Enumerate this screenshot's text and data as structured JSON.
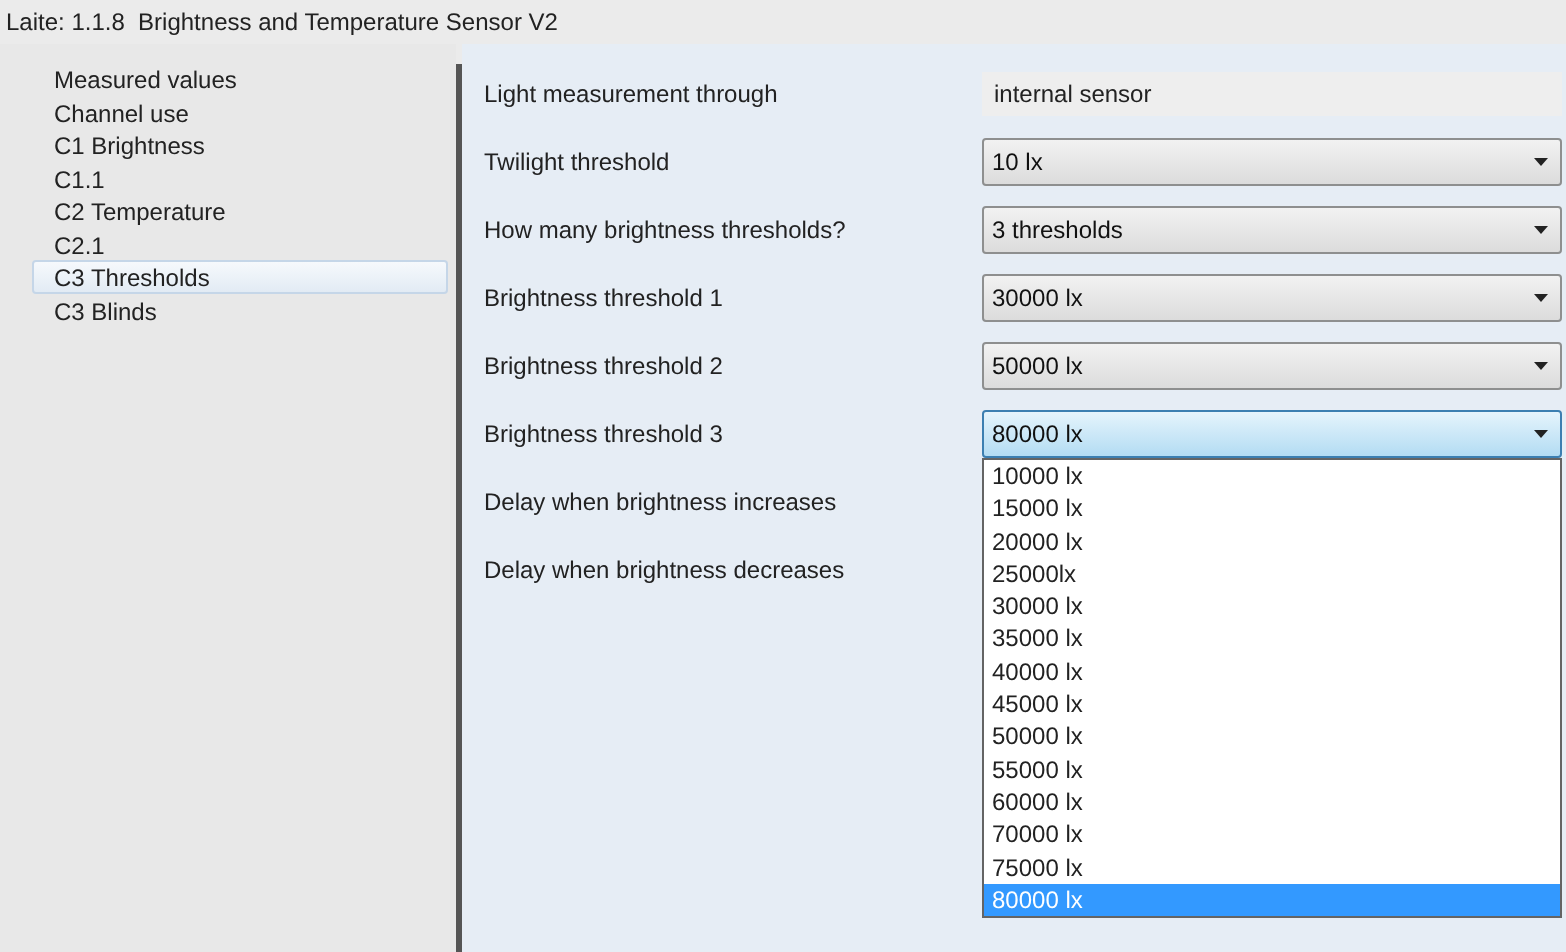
{
  "window": {
    "title": "Laite: 1.1.8  Brightness and Temperature Sensor V2"
  },
  "sidebar": {
    "items": [
      {
        "label": "Measured values",
        "selected": false
      },
      {
        "label": "Channel use",
        "selected": false
      },
      {
        "label": "C1 Brightness",
        "selected": false
      },
      {
        "label": "C1.1",
        "selected": false
      },
      {
        "label": "C2 Temperature",
        "selected": false
      },
      {
        "label": "C2.1",
        "selected": false
      },
      {
        "label": "C3 Thresholds",
        "selected": true
      },
      {
        "label": "C3 Blinds",
        "selected": false
      }
    ]
  },
  "parameters": [
    {
      "label": "Light measurement through",
      "kind": "text",
      "value": "internal sensor"
    },
    {
      "label": "Twilight threshold",
      "kind": "select",
      "value": "10 lx",
      "expanded": false
    },
    {
      "label": "How many brightness thresholds?",
      "kind": "select",
      "value": "3 thresholds",
      "expanded": false
    },
    {
      "label": "Brightness threshold 1",
      "kind": "select",
      "value": "30000 lx",
      "expanded": false
    },
    {
      "label": "Brightness threshold 2",
      "kind": "select",
      "value": "50000 lx",
      "expanded": false
    },
    {
      "label": "Brightness threshold 3",
      "kind": "select",
      "value": "80000 lx",
      "expanded": true,
      "options": [
        {
          "label": "10000 lx",
          "selected": false
        },
        {
          "label": "15000 lx",
          "selected": false
        },
        {
          "label": "20000 lx",
          "selected": false
        },
        {
          "label": "25000lx",
          "selected": false
        },
        {
          "label": "30000 lx",
          "selected": false
        },
        {
          "label": "35000 lx",
          "selected": false
        },
        {
          "label": "40000 lx",
          "selected": false
        },
        {
          "label": "45000 lx",
          "selected": false
        },
        {
          "label": "50000 lx",
          "selected": false
        },
        {
          "label": "55000 lx",
          "selected": false
        },
        {
          "label": "60000 lx",
          "selected": false
        },
        {
          "label": "70000 lx",
          "selected": false
        },
        {
          "label": "75000 lx",
          "selected": false
        },
        {
          "label": "80000 lx",
          "selected": true
        }
      ]
    },
    {
      "label": "Delay when brightness increases",
      "kind": "label"
    },
    {
      "label": "Delay when brightness decreases",
      "kind": "label"
    }
  ]
}
